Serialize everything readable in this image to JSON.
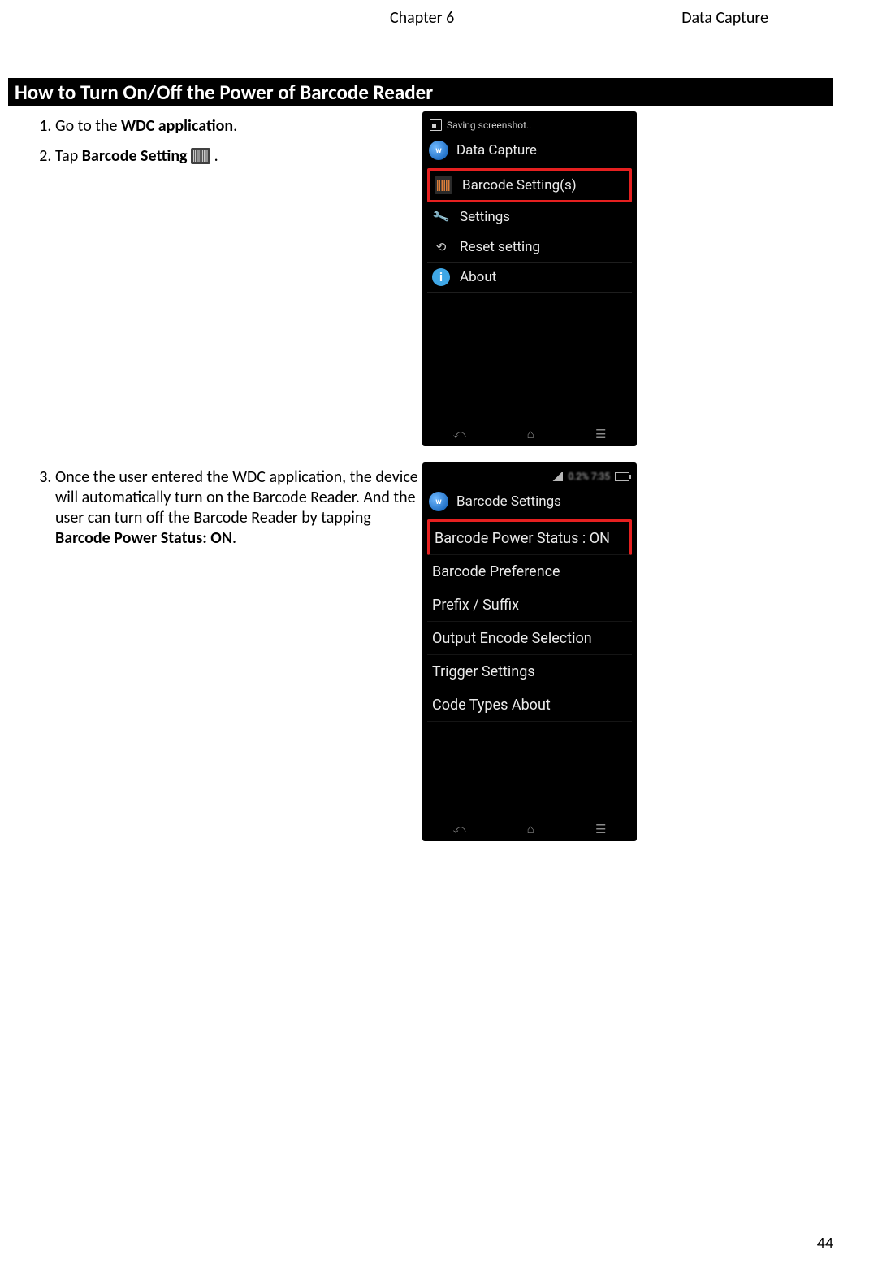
{
  "header": {
    "chapter": "Chapter 6",
    "section": "Data Capture"
  },
  "heading": "How to Turn On/Off the Power of Barcode Reader",
  "steps": {
    "s1_pre": "Go to the ",
    "s1_bold": "WDC application",
    "s1_post": ".",
    "s2_pre": "Tap ",
    "s2_bold": "Barcode Setting",
    "s2_post": " .",
    "s3_pre": "Once the user entered the WDC application, the device will automatically turn on the Barcode Reader. And the user can turn off the Barcode Reader by tapping ",
    "s3_bold": "Barcode Power Status: ON",
    "s3_post": "."
  },
  "phone1": {
    "status_text": "Saving screenshot..",
    "app_title": "Data Capture",
    "items": {
      "barcode": "Barcode Setting(s)",
      "settings": "Settings",
      "reset": "Reset setting",
      "about": "About"
    }
  },
  "phone2": {
    "status_right": "0.2%   7:35",
    "app_title": "Barcode Settings",
    "items": {
      "power": "Barcode Power Status : ON",
      "pref": "Barcode Preference",
      "prefix": "Prefix / Suffix",
      "encode": "Output Encode Selection",
      "trigger": "Trigger Settings",
      "codetypes": "Code Types About"
    }
  },
  "page_number": "44"
}
